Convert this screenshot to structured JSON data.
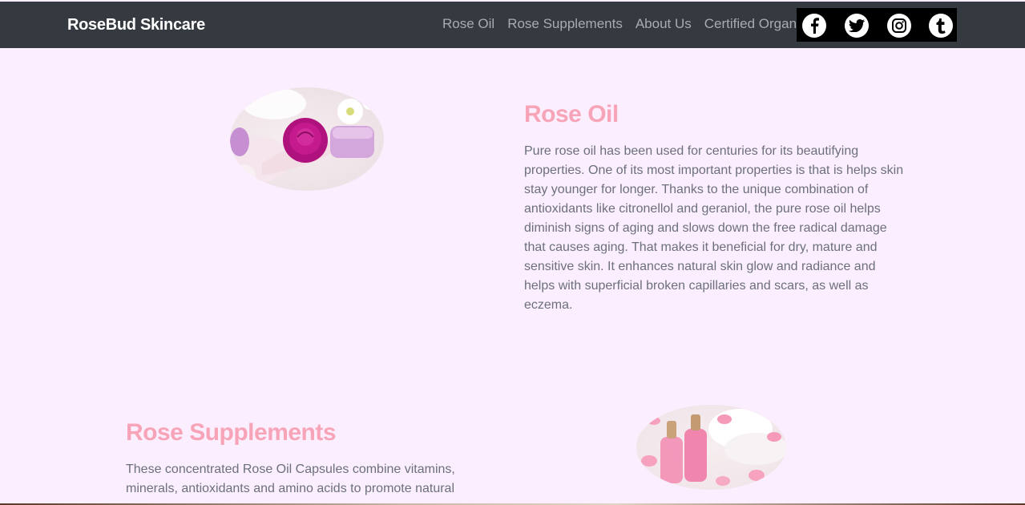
{
  "navbar": {
    "brand": "RoseBud Skincare",
    "links": [
      "Rose Oil",
      "Rose Supplements",
      "About Us",
      "Certified Organic"
    ],
    "social": [
      "facebook-icon",
      "twitter-icon",
      "instagram-icon",
      "tumblr-icon"
    ]
  },
  "sections": [
    {
      "title": "Rose Oil",
      "text": "Pure rose oil has been used for centuries for its beautifying properties. One of its most important properties is that is helps skin stay younger for longer. Thanks to the unique combination of antioxidants like citronellol and geraniol, the pure rose oil helps diminish signs of aging and slows down the free radical damage that causes aging. That makes it beneficial for dry, mature and sensitive skin. It enhances natural skin glow and radiance and helps with superficial broken capillaries and scars, as well as eczema."
    },
    {
      "title": "Rose Supplements",
      "text": "These concentrated Rose Oil Capsules combine vitamins, minerals, antioxidants and amino acids to promote natural"
    }
  ],
  "colors": {
    "navbar_bg": "#343a40",
    "page_bg": "#fbeefe",
    "title": "#f8a4b8",
    "body_text": "#6c707a",
    "nav_link": "#a8abaf"
  }
}
